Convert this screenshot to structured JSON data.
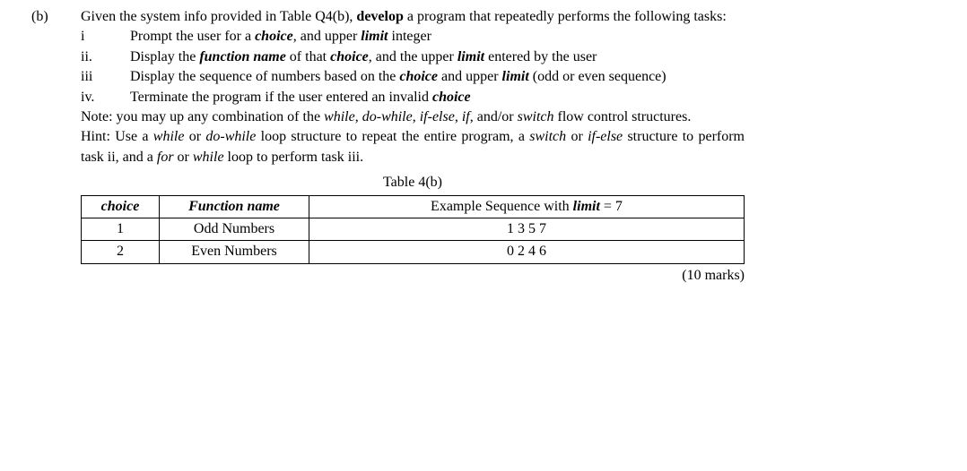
{
  "part_label": "(b)",
  "intro": {
    "t1": "Given the system info provided in Table Q4(b), ",
    "t2": "develop",
    "t3": " a program that repeatedly performs the following tasks:"
  },
  "tasks": {
    "i_num": "i",
    "i": {
      "t1": "Prompt the user for a ",
      "t2": "choice",
      "t3": ", and upper ",
      "t4": "limit",
      "t5": " integer"
    },
    "ii_num": "ii.",
    "ii": {
      "t1": "Display the ",
      "t2": "function name",
      "t3": " of that ",
      "t4": "choice",
      "t5": ", and the upper ",
      "t6": "limit",
      "t7": " entered by the user"
    },
    "iii_num": "iii",
    "iii": {
      "t1": "Display the sequence of numbers based on the ",
      "t2": "choice",
      "t3": " and upper ",
      "t4": "limit",
      "t5": " (odd or even sequence)"
    },
    "iv_num": "iv.",
    "iv": {
      "t1": "Terminate the program if the user entered an invalid ",
      "t2": "choice"
    }
  },
  "note": {
    "t1": "Note: you may up any combination of the ",
    "t2": "while",
    "c1": ", ",
    "t3": "do-while",
    "c2": ", ",
    "t4": "if-else",
    "c3": ", ",
    "t5": "if",
    "c4": ", and/or ",
    "t6": "switch",
    "t7": " flow control structures."
  },
  "hint": {
    "t1": "Hint: Use a ",
    "t2": "while",
    "c1": " or ",
    "t3": "do-while",
    "t4": " loop structure to repeat the entire program, a ",
    "t5": "switch",
    "c2": " or ",
    "t6": "if-else",
    "t7": " structure to perform task ii, and a ",
    "t8": "for",
    "c3": " or ",
    "t9": "while",
    "t10": " loop to perform task iii."
  },
  "table": {
    "caption": "Table 4(b)",
    "headers": {
      "h1": "choice",
      "h2": "Function name",
      "h3a": "Example Sequence with ",
      "h3b": "limit",
      "h3c": " = 7"
    },
    "rows": [
      {
        "c1": "1",
        "c2": "Odd Numbers",
        "c3": "1 3 5 7"
      },
      {
        "c1": "2",
        "c2": "Even Numbers",
        "c3": "0 2 4 6"
      }
    ]
  },
  "marks": "(10 marks)"
}
